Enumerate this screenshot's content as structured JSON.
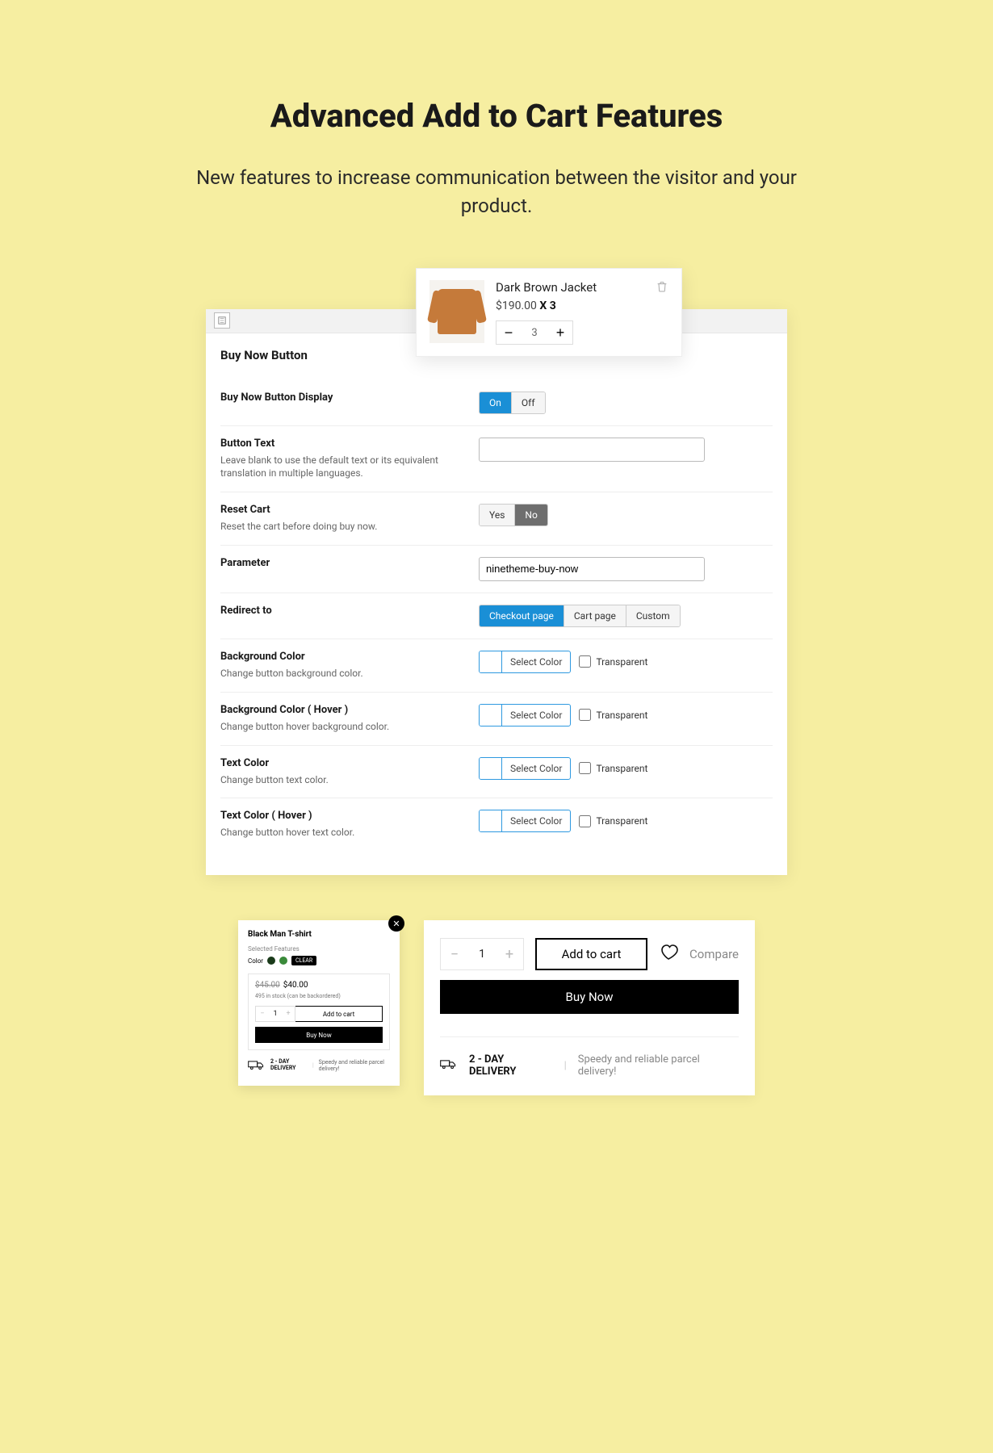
{
  "headline": "Advanced Add to Cart Features",
  "subline": "New features to increase communication between the visitor and your product.",
  "panel": {
    "section_title": "Buy Now Button",
    "rows": {
      "display": {
        "label": "Buy Now Button Display",
        "opt_on": "On",
        "opt_off": "Off"
      },
      "button_text": {
        "label": "Button Text",
        "desc": "Leave blank to use the default text or its equivalent translation in multiple languages."
      },
      "reset_cart": {
        "label": "Reset Cart",
        "desc": "Reset the cart before doing buy now.",
        "yes": "Yes",
        "no": "No"
      },
      "parameter": {
        "label": "Parameter",
        "value": "ninetheme-buy-now"
      },
      "redirect": {
        "label": "Redirect to",
        "checkout": "Checkout page",
        "cart": "Cart page",
        "custom": "Custom"
      },
      "bg": {
        "label": "Background Color",
        "desc": "Change button background color."
      },
      "bg_hover": {
        "label": "Background Color ( Hover )",
        "desc": "Change button hover background color."
      },
      "txt": {
        "label": "Text Color",
        "desc": "Change button text color."
      },
      "txt_hover": {
        "label": "Text Color ( Hover )",
        "desc": "Change button hover text color."
      }
    },
    "select_color": "Select Color",
    "transparent": "Transparent"
  },
  "mini_cart": {
    "title": "Dark Brown Jacket",
    "price": "$190.00",
    "x": "X 3",
    "qty": "3"
  },
  "popup": {
    "title": "Black Man T-shirt",
    "selected": "Selected Features",
    "color_label": "Color",
    "clear": "CLEAR",
    "old_price": "$45.00",
    "price": "$40.00",
    "stock": "495 in stock (can be backordered)",
    "qty": "1",
    "atc": "Add to cart",
    "buy": "Buy Now",
    "del_title": "2 - DAY DELIVERY",
    "del_text": "Speedy and reliable parcel delivery!"
  },
  "prod": {
    "qty": "1",
    "atc": "Add to cart",
    "compare": "Compare",
    "buy": "Buy Now",
    "del_title": "2 - DAY DELIVERY",
    "del_text": "Speedy and reliable parcel delivery!"
  }
}
